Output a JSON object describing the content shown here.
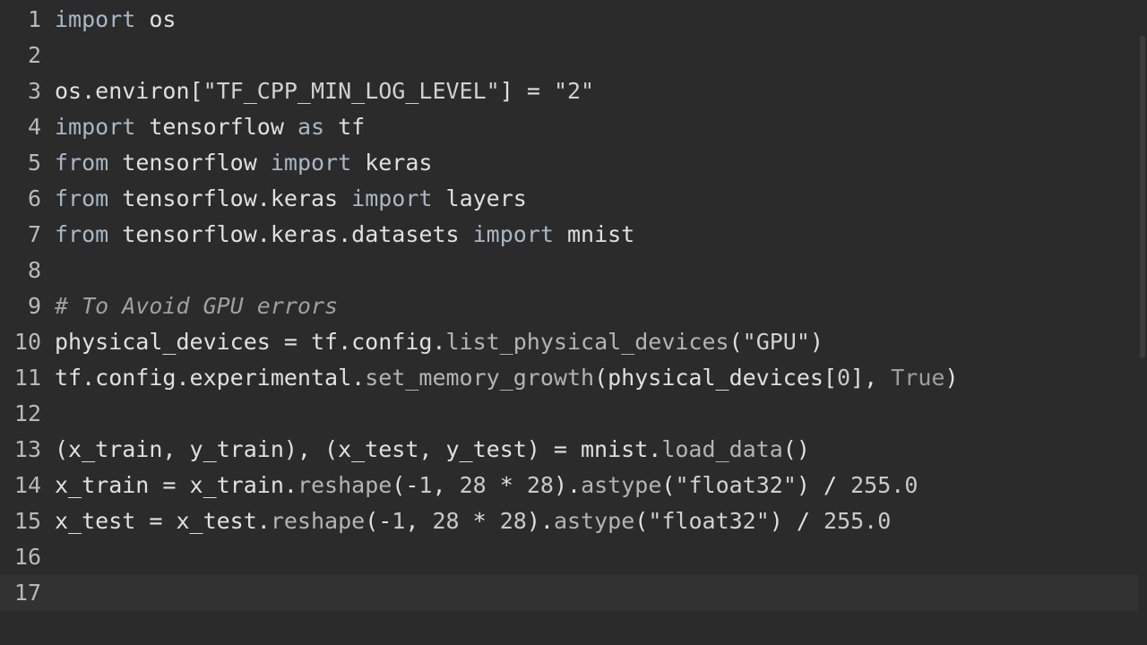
{
  "editor": {
    "current_line": 17,
    "lines": [
      {
        "number": "1",
        "tokens": [
          {
            "text": "import",
            "kind": "kw"
          },
          {
            "text": " os",
            "kind": "plain"
          }
        ]
      },
      {
        "number": "2",
        "tokens": []
      },
      {
        "number": "3",
        "tokens": [
          {
            "text": "os.environ[",
            "kind": "plain"
          },
          {
            "text": "\"TF_CPP_MIN_LOG_LEVEL\"",
            "kind": "str"
          },
          {
            "text": "] = ",
            "kind": "plain"
          },
          {
            "text": "\"2\"",
            "kind": "str"
          }
        ]
      },
      {
        "number": "4",
        "tokens": [
          {
            "text": "import",
            "kind": "kw"
          },
          {
            "text": " tensorflow ",
            "kind": "plain"
          },
          {
            "text": "as",
            "kind": "kw"
          },
          {
            "text": " tf",
            "kind": "plain"
          }
        ]
      },
      {
        "number": "5",
        "tokens": [
          {
            "text": "from",
            "kind": "kw"
          },
          {
            "text": " tensorflow ",
            "kind": "plain"
          },
          {
            "text": "import",
            "kind": "kw"
          },
          {
            "text": " keras",
            "kind": "plain"
          }
        ]
      },
      {
        "number": "6",
        "tokens": [
          {
            "text": "from",
            "kind": "kw"
          },
          {
            "text": " tensorflow.keras ",
            "kind": "plain"
          },
          {
            "text": "import",
            "kind": "kw"
          },
          {
            "text": " layers",
            "kind": "plain"
          }
        ]
      },
      {
        "number": "7",
        "tokens": [
          {
            "text": "from",
            "kind": "kw"
          },
          {
            "text": " tensorflow.keras.datasets ",
            "kind": "plain"
          },
          {
            "text": "import",
            "kind": "kw"
          },
          {
            "text": " mnist",
            "kind": "plain"
          }
        ]
      },
      {
        "number": "8",
        "tokens": []
      },
      {
        "number": "9",
        "tokens": [
          {
            "text": "# To Avoid GPU errors",
            "kind": "comment"
          }
        ]
      },
      {
        "number": "10",
        "tokens": [
          {
            "text": "physical_devices = tf.config.",
            "kind": "plain"
          },
          {
            "text": "list_physical_devices",
            "kind": "fn"
          },
          {
            "text": "(",
            "kind": "plain"
          },
          {
            "text": "\"GPU\"",
            "kind": "str"
          },
          {
            "text": ")",
            "kind": "plain"
          }
        ]
      },
      {
        "number": "11",
        "tokens": [
          {
            "text": "tf.config.experimental.",
            "kind": "plain"
          },
          {
            "text": "set_memory_growth",
            "kind": "fn"
          },
          {
            "text": "(physical_devices[",
            "kind": "plain"
          },
          {
            "text": "0",
            "kind": "num"
          },
          {
            "text": "], ",
            "kind": "plain"
          },
          {
            "text": "True",
            "kind": "const"
          },
          {
            "text": ")",
            "kind": "plain"
          }
        ]
      },
      {
        "number": "12",
        "tokens": []
      },
      {
        "number": "13",
        "tokens": [
          {
            "text": "(x_train, y_train), (x_test, y_test) = mnist.",
            "kind": "plain"
          },
          {
            "text": "load_data",
            "kind": "fn"
          },
          {
            "text": "()",
            "kind": "plain"
          }
        ]
      },
      {
        "number": "14",
        "tokens": [
          {
            "text": "x_train = x_train.",
            "kind": "plain"
          },
          {
            "text": "reshape",
            "kind": "fn"
          },
          {
            "text": "(-",
            "kind": "plain"
          },
          {
            "text": "1",
            "kind": "num"
          },
          {
            "text": ", ",
            "kind": "plain"
          },
          {
            "text": "28",
            "kind": "num"
          },
          {
            "text": " * ",
            "kind": "plain"
          },
          {
            "text": "28",
            "kind": "num"
          },
          {
            "text": ").",
            "kind": "plain"
          },
          {
            "text": "astype",
            "kind": "fn"
          },
          {
            "text": "(",
            "kind": "plain"
          },
          {
            "text": "\"float32\"",
            "kind": "str"
          },
          {
            "text": ") / ",
            "kind": "plain"
          },
          {
            "text": "255.0",
            "kind": "num"
          }
        ]
      },
      {
        "number": "15",
        "tokens": [
          {
            "text": "x_test = x_test.",
            "kind": "plain"
          },
          {
            "text": "reshape",
            "kind": "fn"
          },
          {
            "text": "(-",
            "kind": "plain"
          },
          {
            "text": "1",
            "kind": "num"
          },
          {
            "text": ", ",
            "kind": "plain"
          },
          {
            "text": "28",
            "kind": "num"
          },
          {
            "text": " * ",
            "kind": "plain"
          },
          {
            "text": "28",
            "kind": "num"
          },
          {
            "text": ").",
            "kind": "plain"
          },
          {
            "text": "astype",
            "kind": "fn"
          },
          {
            "text": "(",
            "kind": "plain"
          },
          {
            "text": "\"float32\"",
            "kind": "str"
          },
          {
            "text": ") / ",
            "kind": "plain"
          },
          {
            "text": "255.0",
            "kind": "num"
          }
        ]
      },
      {
        "number": "16",
        "tokens": []
      },
      {
        "number": "17",
        "tokens": []
      }
    ]
  }
}
